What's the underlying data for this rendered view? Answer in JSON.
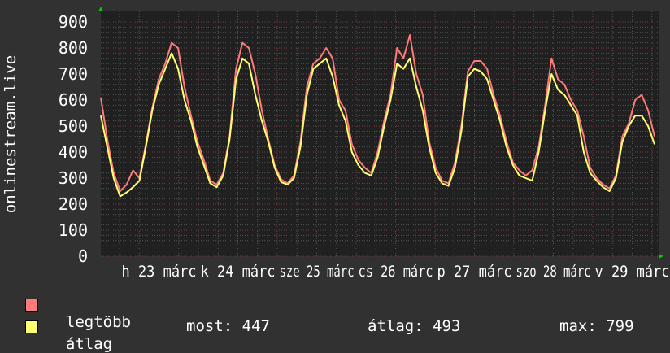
{
  "chart_data": {
    "type": "line",
    "ylabel": "onlinestream.live",
    "ylim": [
      0,
      900
    ],
    "yticks": [
      0,
      100,
      200,
      300,
      400,
      500,
      600,
      700,
      800,
      900
    ],
    "xtick_labels": [
      "h 23 márc",
      "k 24 márc",
      "sze 25 márc",
      "cs 26 márc",
      "p 27 márc",
      "szo 28 márc",
      "v 29 márc"
    ],
    "grid": true,
    "colors": {
      "background": "#313131",
      "plot": "#202020",
      "grid_minor": "#555555",
      "grid_major": "#7a3a3a",
      "arrow": "#00cc00"
    },
    "series": [
      {
        "name": "legtöbb",
        "color": "#ff7a7a",
        "values": [
          610,
          450,
          320,
          250,
          275,
          330,
          300,
          430,
          570,
          680,
          740,
          820,
          800,
          650,
          540,
          440,
          370,
          290,
          275,
          320,
          460,
          720,
          820,
          800,
          700,
          560,
          450,
          350,
          295,
          280,
          310,
          440,
          650,
          740,
          760,
          800,
          760,
          600,
          560,
          430,
          370,
          340,
          320,
          400,
          520,
          620,
          800,
          760,
          850,
          700,
          620,
          440,
          340,
          290,
          280,
          360,
          500,
          710,
          750,
          750,
          720,
          620,
          540,
          440,
          360,
          330,
          310,
          330,
          420,
          580,
          760,
          680,
          660,
          600,
          560,
          460,
          340,
          300,
          275,
          260,
          310,
          460,
          510,
          600,
          620,
          560,
          460
        ]
      },
      {
        "name": "átlag",
        "color": "#ffff70",
        "values": [
          540,
          420,
          300,
          230,
          245,
          265,
          290,
          420,
          560,
          660,
          720,
          780,
          720,
          600,
          520,
          420,
          350,
          280,
          265,
          310,
          450,
          680,
          760,
          740,
          620,
          520,
          440,
          340,
          285,
          275,
          300,
          420,
          620,
          720,
          740,
          760,
          690,
          580,
          520,
          400,
          350,
          320,
          310,
          380,
          500,
          600,
          740,
          720,
          760,
          650,
          560,
          420,
          320,
          280,
          270,
          340,
          480,
          690,
          720,
          710,
          680,
          600,
          520,
          420,
          350,
          310,
          300,
          290,
          400,
          560,
          700,
          640,
          620,
          580,
          540,
          400,
          320,
          290,
          265,
          250,
          300,
          440,
          500,
          540,
          540,
          500,
          430
        ]
      }
    ]
  },
  "legend": {
    "max_label": "legtöbb",
    "avg_label": "átlag",
    "most": "most: 447",
    "atlag": "átlag: 493",
    "max": "max: 799"
  }
}
